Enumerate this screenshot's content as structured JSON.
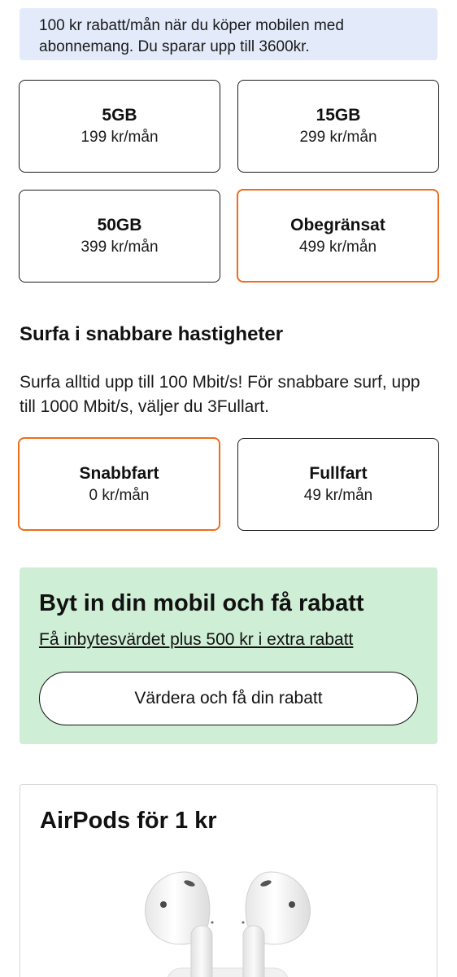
{
  "banner": {
    "text": "100 kr rabatt/mån när du köper mobilen med abonnemang. Du sparar upp till 3600kr."
  },
  "data_plans": [
    {
      "title": "5GB",
      "price": "199 kr/mån",
      "selected": false
    },
    {
      "title": "15GB",
      "price": "299 kr/mån",
      "selected": false
    },
    {
      "title": "50GB",
      "price": "399 kr/mån",
      "selected": false
    },
    {
      "title": "Obegränsat",
      "price": "499 kr/mån",
      "selected": true
    }
  ],
  "speed": {
    "title": "Surfa i snabbare hastigheter",
    "description": "Surfa alltid upp till 100 Mbit/s! För snabbare surf, upp till 1000 Mbit/s, väljer du 3Fullart.",
    "options": [
      {
        "title": "Snabbfart",
        "price": "0 kr/mån",
        "selected": true
      },
      {
        "title": "Fullfart",
        "price": "49 kr/mån",
        "selected": false
      }
    ]
  },
  "tradein": {
    "title": "Byt in din mobil och få rabatt",
    "link": "Få inbytesvärdet plus 500 kr i extra rabatt",
    "button": "Värdera och få din rabatt"
  },
  "promo": {
    "title": "AirPods för 1 kr",
    "image_icon": "airpods-image"
  },
  "colors": {
    "accent": "#ef6c1a",
    "banner_bg": "#e3ebfb",
    "tradein_bg": "#cfeed6"
  }
}
